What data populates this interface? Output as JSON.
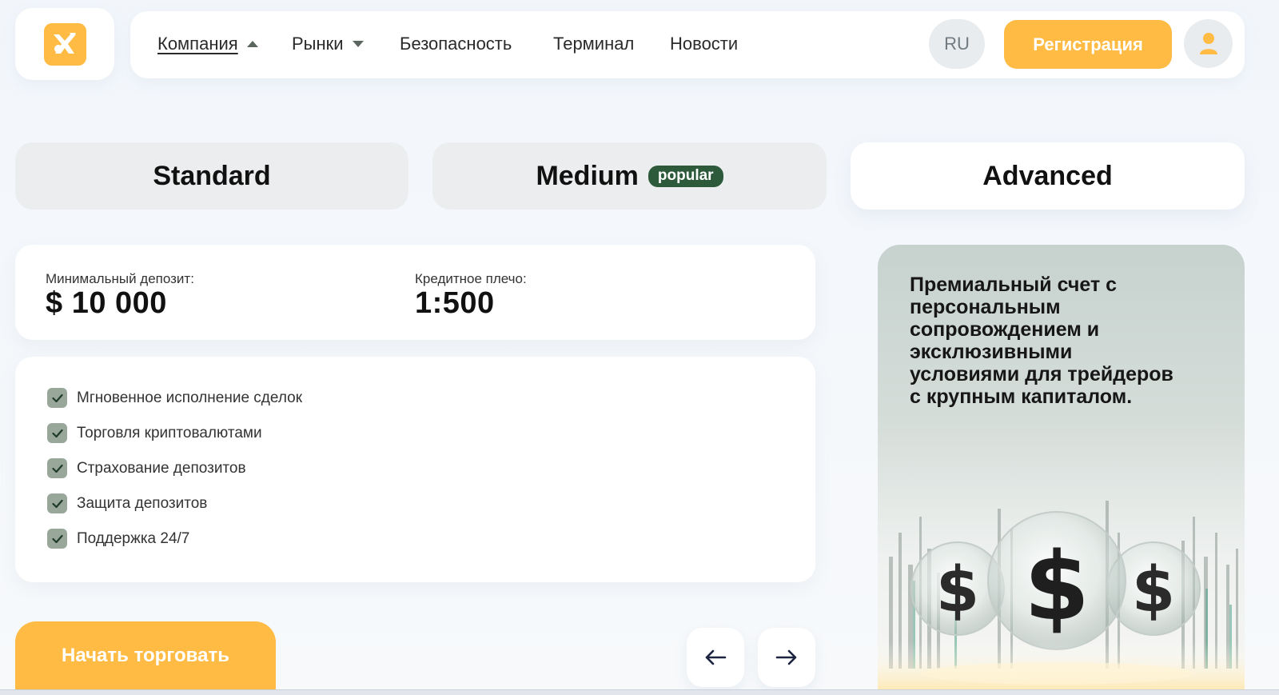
{
  "header": {
    "nav": [
      {
        "label": "Компания",
        "active": true,
        "caret": "up"
      },
      {
        "label": "Рынки",
        "active": false,
        "caret": "down"
      },
      {
        "label": "Безопасность",
        "active": false
      },
      {
        "label": "Терминал",
        "active": false
      },
      {
        "label": "Новости",
        "active": false
      }
    ],
    "lang": "RU",
    "register": "Регистрация"
  },
  "tabs": {
    "standard": "Standard",
    "medium": "Medium",
    "medium_badge": "popular",
    "advanced": "Advanced",
    "selected": "Advanced"
  },
  "account": {
    "min_deposit_label": "Минимальный депозит:",
    "min_deposit_value": "$ 10 000",
    "leverage_label": "Кредитное плечо:",
    "leverage_value": "1:500"
  },
  "features": [
    "Мгновенное исполнение сделок",
    "Торговля криптовалютами",
    "Страхование депозитов",
    "Защита депозитов",
    "Поддержка 24/7"
  ],
  "promo": {
    "text": "Премиальный счет с персональным сопровождением и эксклюзивными условиями для трейдеров с крупным капиталом."
  },
  "cta": {
    "start": "Начать торговать"
  },
  "colors": {
    "accent": "#ffbb44",
    "badge": "#2e5a3c",
    "check": "#98a79a"
  },
  "icons": {
    "logo": "brand-logo-icon",
    "avatar": "user-icon",
    "prev": "arrow-left-icon",
    "next": "arrow-right-icon"
  }
}
